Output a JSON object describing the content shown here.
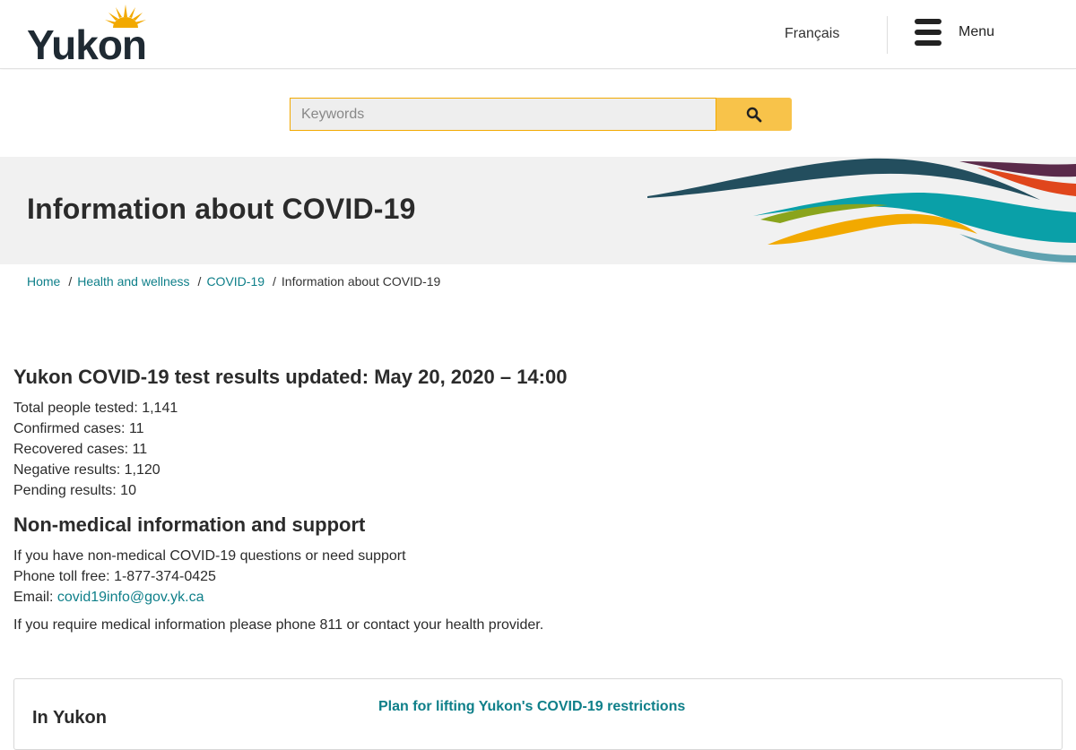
{
  "header": {
    "logo_text": "Yukon",
    "language_link": "Français",
    "menu_label": "Menu"
  },
  "search": {
    "placeholder": "Keywords"
  },
  "banner": {
    "title": "Information about COVID-19"
  },
  "breadcrumb": {
    "items": [
      "Home",
      "Health and wellness",
      "COVID-19"
    ],
    "current": "Information about COVID-19"
  },
  "test_results": {
    "heading": "Yukon COVID-19 test results updated: May 20, 2020 – 14:00",
    "lines": [
      "Total people tested: 1,141",
      "Confirmed cases: 11",
      "Recovered cases: 11",
      "Negative results: 1,120",
      "Pending results: 10"
    ]
  },
  "support": {
    "heading": "Non-medical information and support",
    "intro": "If you have non-medical COVID-19 questions or need support",
    "phone": "Phone toll free: 1-877-374-0425",
    "email_label": "Email: ",
    "email": "covid19info@gov.yk.ca",
    "medical_note": "If you require medical information please phone 811 or contact your health provider."
  },
  "card": {
    "left_title": "In Yukon",
    "link": "Plan for lifting Yukon's COVID-19 restrictions"
  },
  "colors": {
    "link": "#0e7f89",
    "accent_yellow": "#f8c34a",
    "banner_bg": "#f1f1f1"
  }
}
